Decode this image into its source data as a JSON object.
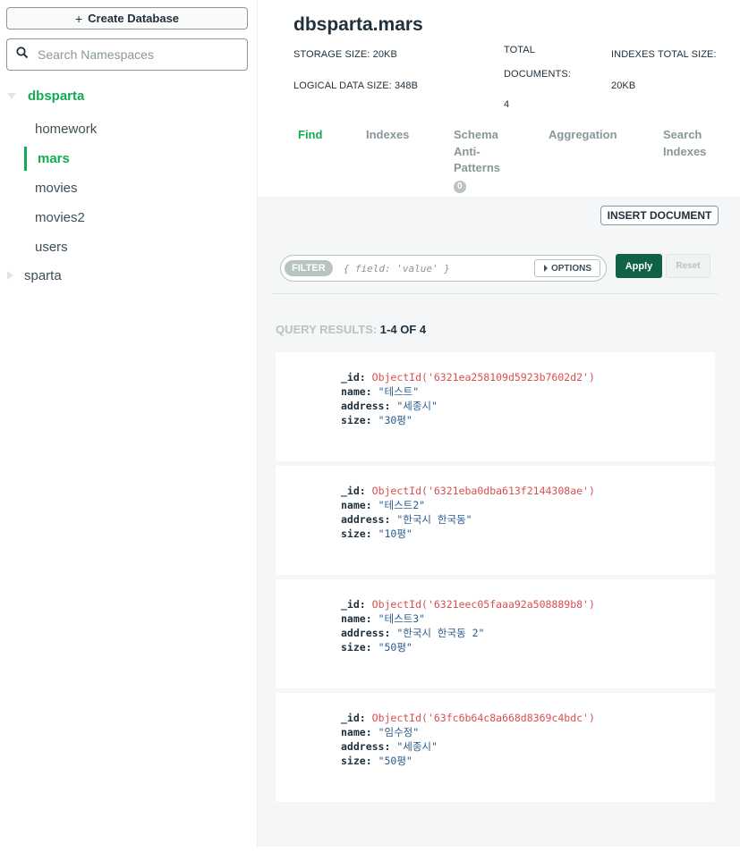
{
  "sidebar": {
    "create_db_label": "Create Database",
    "search_placeholder": "Search Namespaces",
    "databases": [
      {
        "name": "dbsparta",
        "expanded": true,
        "collections": [
          "homework",
          "mars",
          "movies",
          "movies2",
          "users"
        ],
        "active_collection": "mars"
      },
      {
        "name": "sparta",
        "expanded": false
      }
    ]
  },
  "header": {
    "namespace": "dbsparta.mars",
    "storage_size_label": "STORAGE SIZE:",
    "storage_size": "20KB",
    "logical_size_label": "LOGICAL DATA SIZE:",
    "logical_size": "348B",
    "total_docs_label_1": "TOTAL",
    "total_docs_label_2": "DOCUMENTS:",
    "total_docs": "4",
    "indexes_size_label": "INDEXES TOTAL SIZE:",
    "indexes_size": "20KB"
  },
  "tabs": [
    {
      "label": "Find",
      "active": true
    },
    {
      "label": "Indexes"
    },
    {
      "label_lines": [
        "Schema",
        "Anti-",
        "Patterns"
      ],
      "badge": "0"
    },
    {
      "label": "Aggregation"
    },
    {
      "label_lines": [
        "Search",
        "Indexes"
      ]
    }
  ],
  "toolbar": {
    "insert_document": "INSERT DOCUMENT",
    "filter_label": "FILTER",
    "filter_placeholder": "{ field: 'value' }",
    "options_label": "OPTIONS",
    "apply_label": "Apply",
    "reset_label": "Reset"
  },
  "results": {
    "label": "QUERY RESULTS:",
    "count": "1-4 OF 4"
  },
  "documents": [
    {
      "id": "ObjectId('6321ea258109d5923b7602d2')",
      "name": "\"테스트\"",
      "address": "\"세종시\"",
      "size": "\"30평\""
    },
    {
      "id": "ObjectId('6321eba0dba613f2144308ae')",
      "name": "\"테스트2\"",
      "address": "\"한국시 한국동\"",
      "size": "\"10평\""
    },
    {
      "id": "ObjectId('6321eec05faaa92a508889b8')",
      "name": "\"테스트3\"",
      "address": "\"한국시 한국동 2\"",
      "size": "\"50평\""
    },
    {
      "id": "ObjectId('63fc6b64c8a668d8369c4bdc')",
      "name": "\"임수정\"",
      "address": "\"세종시\"",
      "size": "\"50평\""
    }
  ],
  "field_keys": {
    "id": "_id:",
    "name": "name:",
    "address": "address:",
    "size": "size:"
  },
  "colors": {
    "accent_green": "#13aa52",
    "apply_green": "#116149",
    "objectid_red": "#d94f4f"
  }
}
